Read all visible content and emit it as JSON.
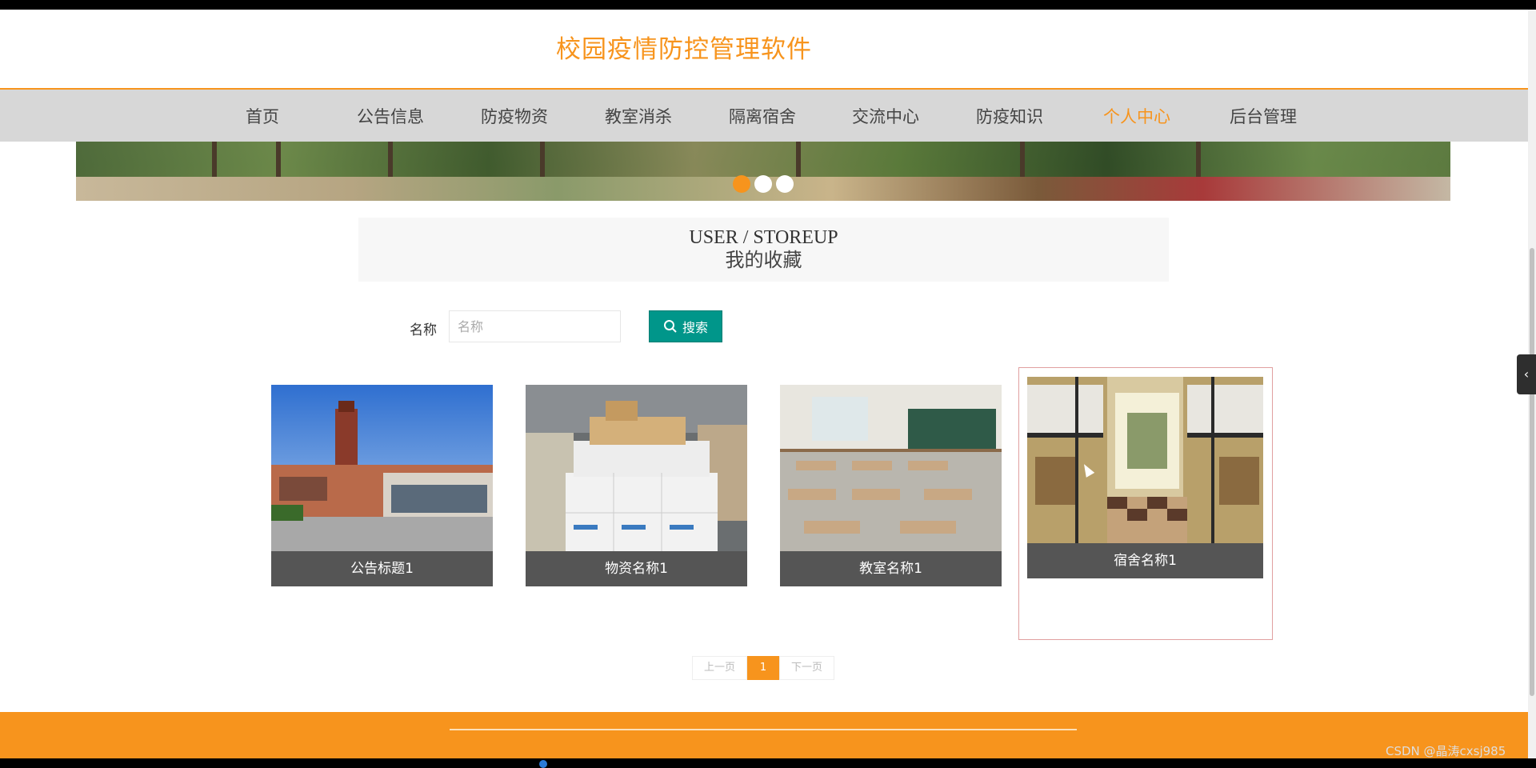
{
  "header": {
    "site_title": "校园疫情防控管理软件"
  },
  "nav": {
    "items": [
      {
        "label": "首页"
      },
      {
        "label": "公告信息"
      },
      {
        "label": "防疫物资"
      },
      {
        "label": "教室消杀"
      },
      {
        "label": "隔离宿舍"
      },
      {
        "label": "交流中心"
      },
      {
        "label": "防疫知识"
      },
      {
        "label": "个人中心",
        "active": true
      },
      {
        "label": "后台管理"
      }
    ]
  },
  "banner": {
    "dot_count": 3,
    "active_dot": 0
  },
  "section": {
    "title_en": "USER / STOREUP",
    "title_cn": "我的收藏"
  },
  "search": {
    "label": "名称",
    "placeholder": "名称",
    "value": "",
    "button_label": "搜索"
  },
  "cards": [
    {
      "caption": "公告标题1",
      "image": "school-building"
    },
    {
      "caption": "物资名称1",
      "image": "supply-boxes"
    },
    {
      "caption": "教室名称1",
      "image": "classroom"
    },
    {
      "caption": "宿舍名称1",
      "image": "dormitory"
    }
  ],
  "pagination": {
    "prev_label": "上一页",
    "current_page": "1",
    "next_label": "下一页"
  },
  "watermark": "CSDN @晶涛cxsj985",
  "side_toggle_icon": "‹",
  "colors": {
    "accent": "#f7941d",
    "search_button": "#00968a",
    "caption_bg": "#555555",
    "nav_bg": "#d7d7d7"
  }
}
